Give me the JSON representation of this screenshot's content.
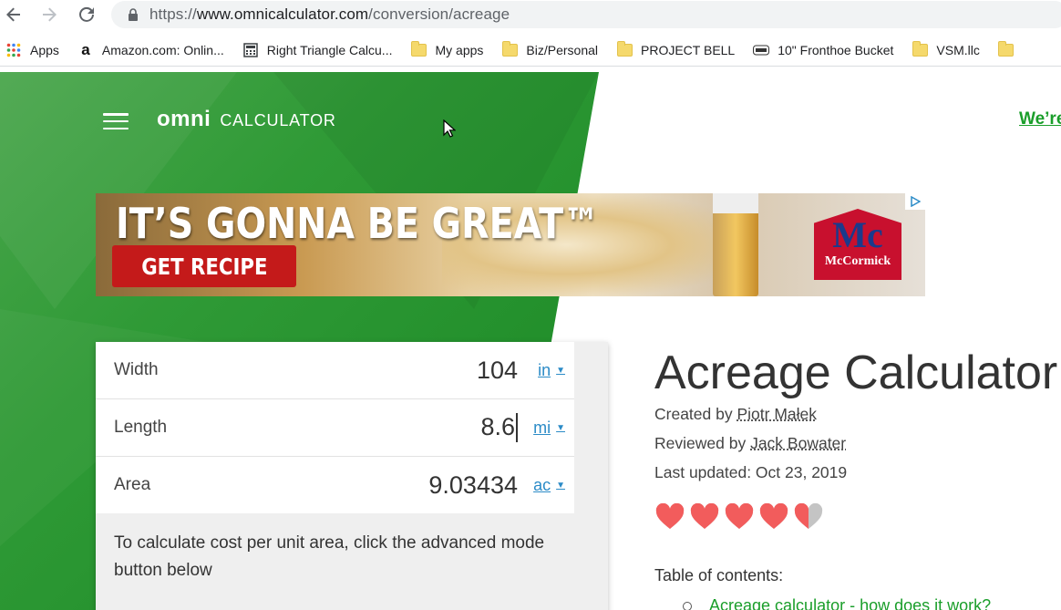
{
  "browser": {
    "url_prefix": "https://",
    "url_host": "www.omnicalculator.com",
    "url_path": "/conversion/acreage",
    "bookmarks": [
      {
        "label": "Apps",
        "icon": "apps-grid-icon"
      },
      {
        "label": "Amazon.com: Onlin...",
        "icon": "amazon-icon"
      },
      {
        "label": "Right Triangle Calcu...",
        "icon": "calculator-icon"
      },
      {
        "label": "My apps",
        "icon": "folder-icon"
      },
      {
        "label": "Biz/Personal",
        "icon": "folder-icon"
      },
      {
        "label": "PROJECT BELL",
        "icon": "folder-icon"
      },
      {
        "label": "10\" Fronthoe Bucket",
        "icon": "site-icon"
      },
      {
        "label": "VSM.llc",
        "icon": "folder-icon"
      }
    ]
  },
  "header": {
    "logo_omni": "omni",
    "logo_calculator": "CALCULATOR",
    "top_link": "We’re"
  },
  "ad": {
    "headline": "IT’S GONNA BE GREAT™",
    "cta": "GET RECIPE",
    "brand": "McCormick",
    "brand_mark": "Mc"
  },
  "calculator": {
    "rows": [
      {
        "label": "Width",
        "value": "104",
        "unit": "in"
      },
      {
        "label": "Length",
        "value": "8.6",
        "unit": "mi"
      },
      {
        "label": "Area",
        "value": "9.03434",
        "unit": "ac"
      }
    ],
    "note": "To calculate cost per unit area, click the advanced mode button below"
  },
  "article": {
    "title": "Acreage Calculator",
    "created_prefix": "Created by",
    "created_by": "Piotr Małek",
    "reviewed_prefix": "Reviewed by",
    "reviewed_by": "Jack Bowater",
    "updated": "Last updated: Oct 23, 2019",
    "rating": 4.5,
    "rating_max": 5,
    "toc_heading": "Table of contents:",
    "toc_items": [
      "Acreage calculator - how does it work?"
    ]
  },
  "colors": {
    "brand_green": "#2f9a36",
    "heart": "#f25c5c",
    "link_blue": "#2b8bc7",
    "link_green": "#1a9e2a"
  }
}
